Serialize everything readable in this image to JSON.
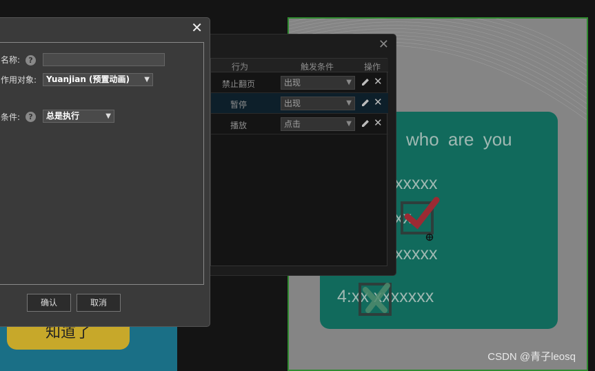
{
  "background": {
    "know_button_label": "知道了"
  },
  "stage": {
    "question": "who are you",
    "options": [
      "xxxxx",
      "xx",
      "xxxxx",
      "4:xx xxxxxxx"
    ],
    "watermark": "CSDN @青子leosq"
  },
  "trigger_dialog": {
    "close_label": "✕",
    "columns": {
      "action": "行为",
      "condition": "触发条件",
      "ops": "操作"
    },
    "rows": [
      {
        "action": "禁止翻页",
        "condition": "出现",
        "selected": false
      },
      {
        "action": "暂停",
        "condition": "出现",
        "selected": true
      },
      {
        "action": "播放",
        "condition": "点击",
        "selected": false
      }
    ]
  },
  "edit_dialog": {
    "close_label": "✕",
    "name_label": "名称:",
    "name_value": "",
    "target_label": "作用对象:",
    "target_value": "Yuanjian (预置动画)",
    "condition_label": "条件:",
    "condition_value": "总是执行",
    "help_glyph": "?",
    "confirm_label": "确认",
    "cancel_label": "取消"
  },
  "colors": {
    "dialog_bg": "#3a3a3a",
    "stage_border": "#2f8a2f",
    "card": "#116a5c",
    "check_mark_red": "#9b2a33",
    "check_mark_green": "#4f8a6c"
  }
}
